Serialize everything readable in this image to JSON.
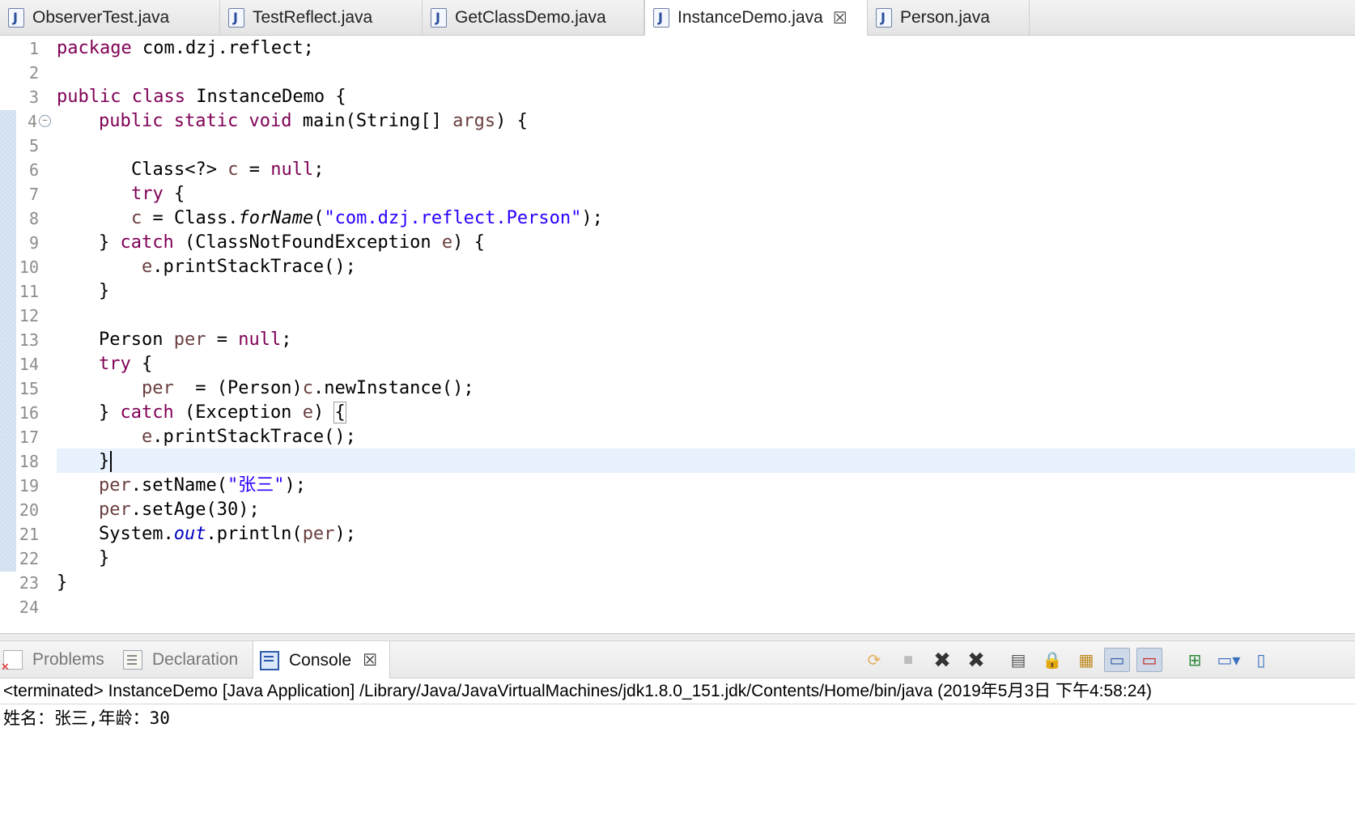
{
  "editor_tabs": [
    {
      "label": "ObserverTest.java",
      "active": false
    },
    {
      "label": "TestReflect.java",
      "active": false
    },
    {
      "label": "GetClassDemo.java",
      "active": false
    },
    {
      "label": "InstanceDemo.java",
      "active": true
    },
    {
      "label": "Person.java",
      "active": false
    }
  ],
  "tab_close_glyph": "☒",
  "line_numbers": [
    "1",
    "2",
    "3",
    "4",
    "5",
    "6",
    "7",
    "8",
    "9",
    "10",
    "11",
    "12",
    "13",
    "14",
    "15",
    "16",
    "17",
    "18",
    "19",
    "20",
    "21",
    "22",
    "23",
    "24"
  ],
  "code": {
    "l1": {
      "kw": "package",
      "rest": " com.dzj.reflect;"
    },
    "l3": {
      "kw1": "public",
      "kw2": "class",
      "rest": " InstanceDemo {"
    },
    "l4": {
      "kw1": "public",
      "kw2": "static",
      "kw3": "void",
      "a": " main(String[] ",
      "var": "args",
      "b": ") {"
    },
    "l6": {
      "a": "Class<?> ",
      "var": "c",
      "b": " = ",
      "kw": "null",
      "c": ";"
    },
    "l7": {
      "kw": "try",
      "rest": " {"
    },
    "l8": {
      "var": "c",
      "a": " = Class.",
      "method": "forName",
      "b": "(",
      "str": "\"com.dzj.reflect.Person\"",
      "c": ");"
    },
    "l9": {
      "a": "} ",
      "kw": "catch",
      "b": " (ClassNotFoundException ",
      "var": "e",
      "c": ") {"
    },
    "l10": {
      "var": "e",
      "rest": ".printStackTrace();"
    },
    "l11": {
      "rest": "}"
    },
    "l13": {
      "a": "Person ",
      "var": "per",
      "b": " = ",
      "kw": "null",
      "c": ";"
    },
    "l14": {
      "kw": "try",
      "rest": " {"
    },
    "l15": {
      "var": "per",
      "a": "  = (Person)",
      "var2": "c",
      "b": ".newInstance();"
    },
    "l16": {
      "a": "} ",
      "kw": "catch",
      "b": " (Exception ",
      "var": "e",
      "c": ") ",
      "bracket": "{"
    },
    "l17": {
      "var": "e",
      "rest": ".printStackTrace();"
    },
    "l18": {
      "rest": "}"
    },
    "l19": {
      "var": "per",
      "a": ".setName(",
      "str": "\"张三\"",
      "b": ");"
    },
    "l20": {
      "var": "per",
      "rest": ".setAge(30);"
    },
    "l21": {
      "a": "System.",
      "field": "out",
      "b": ".println(",
      "var": "per",
      "c": ");"
    },
    "l22": {
      "rest": "}"
    },
    "l23": {
      "rest": "}"
    }
  },
  "bottom_tabs": {
    "problems": "Problems",
    "declaration": "Declaration",
    "console": "Console"
  },
  "console": {
    "header": "<terminated> InstanceDemo [Java Application] /Library/Java/JavaVirtualMachines/jdk1.8.0_151.jdk/Contents/Home/bin/java (2019年5月3日 下午4:58:24)",
    "output": "姓名：张三,年龄：30"
  },
  "toolbar_icons": [
    "pin-link-icon",
    "terminate-icon",
    "remove-launch-icon",
    "remove-all-terminated-icon",
    "clear-console-icon",
    "scroll-lock-icon",
    "word-wrap-icon",
    "show-on-stdout-icon",
    "show-on-stderr-icon",
    "pin-console-icon",
    "display-console-icon"
  ],
  "colors": {
    "keyword": "#7f0055",
    "string": "#2a00ff",
    "field": "#0000c0",
    "local_var": "#6a3e3e",
    "current_line": "#e8f2fe"
  }
}
